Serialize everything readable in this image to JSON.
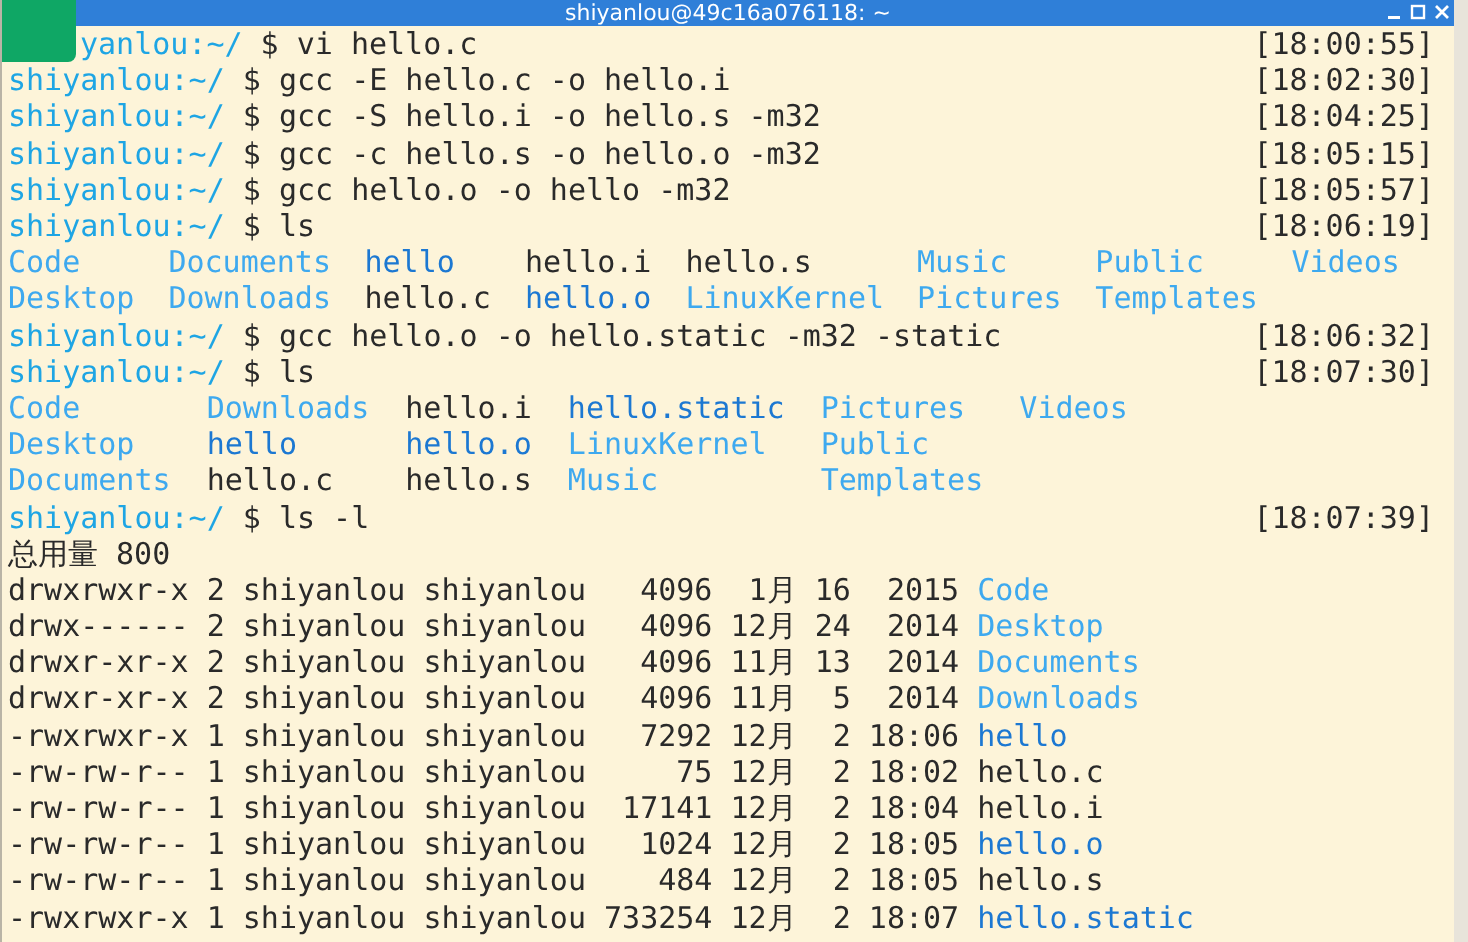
{
  "window": {
    "title": "shiyanlou@49c16a076118: ~"
  },
  "lines": [
    {
      "kind": "command",
      "prompt": "yanlou:~/",
      "command": "$ vi hello.c",
      "time": "[18:00:55]"
    },
    {
      "kind": "command",
      "prompt": "shiyanlou:~/",
      "command": "$ gcc -E hello.c -o hello.i",
      "time": "[18:02:30]"
    },
    {
      "kind": "command",
      "prompt": "shiyanlou:~/",
      "command": "$ gcc -S hello.i -o hello.s -m32",
      "time": "[18:04:25]"
    },
    {
      "kind": "command",
      "prompt": "shiyanlou:~/",
      "command": "$ gcc -c hello.s -o hello.o -m32",
      "time": "[18:05:15]"
    },
    {
      "kind": "command",
      "prompt": "shiyanlou:~/",
      "command": "$ gcc hello.o -o hello -m32",
      "time": "[18:05:57]"
    },
    {
      "kind": "command",
      "prompt": "shiyanlou:~/",
      "command": "$ ls",
      "time": "[18:06:19]"
    },
    {
      "kind": "listing",
      "columns": [
        [
          {
            "name": "Code",
            "kind": "dir"
          },
          {
            "name": "Desktop",
            "kind": "dir"
          }
        ],
        [
          {
            "name": "Documents",
            "kind": "dir"
          },
          {
            "name": "Downloads",
            "kind": "dir"
          }
        ],
        [
          {
            "name": "hello",
            "kind": "binary"
          },
          {
            "name": "hello.c",
            "kind": "plain"
          }
        ],
        [
          {
            "name": "hello.i",
            "kind": "plain"
          },
          {
            "name": "hello.o",
            "kind": "binary"
          }
        ],
        [
          {
            "name": "hello.s",
            "kind": "plain"
          },
          {
            "name": "LinuxKernel",
            "kind": "dir"
          }
        ],
        [
          {
            "name": "Music",
            "kind": "dir"
          },
          {
            "name": "Pictures",
            "kind": "dir"
          }
        ],
        [
          {
            "name": "Public",
            "kind": "dir"
          },
          {
            "name": "Templates",
            "kind": "dir"
          }
        ],
        [
          {
            "name": "Videos",
            "kind": "dir"
          }
        ]
      ]
    },
    {
      "kind": "command",
      "prompt": "shiyanlou:~/",
      "command": "$ gcc hello.o -o hello.static -m32 -static",
      "time": "[18:06:32]"
    },
    {
      "kind": "command",
      "prompt": "shiyanlou:~/",
      "command": "$ ls",
      "time": "[18:07:30]"
    },
    {
      "kind": "listing",
      "columns": [
        [
          {
            "name": "Code",
            "kind": "dir"
          },
          {
            "name": "Desktop",
            "kind": "dir"
          },
          {
            "name": "Documents",
            "kind": "dir"
          }
        ],
        [
          {
            "name": "Downloads",
            "kind": "dir"
          },
          {
            "name": "hello",
            "kind": "binary"
          },
          {
            "name": "hello.c",
            "kind": "plain"
          }
        ],
        [
          {
            "name": "hello.i",
            "kind": "plain"
          },
          {
            "name": "hello.o",
            "kind": "binary"
          },
          {
            "name": "hello.s",
            "kind": "plain"
          }
        ],
        [
          {
            "name": "hello.static",
            "kind": "binary"
          },
          {
            "name": "LinuxKernel",
            "kind": "dir"
          },
          {
            "name": "Music",
            "kind": "dir"
          }
        ],
        [
          {
            "name": "Pictures",
            "kind": "dir"
          },
          {
            "name": "Public",
            "kind": "dir"
          },
          {
            "name": "Templates",
            "kind": "dir"
          }
        ],
        [
          {
            "name": "Videos",
            "kind": "dir"
          }
        ]
      ]
    },
    {
      "kind": "command",
      "prompt": "shiyanlou:~/",
      "command": "$ ls -l",
      "time": "[18:07:39]"
    },
    {
      "kind": "text",
      "text": "总用量 800"
    },
    {
      "kind": "long",
      "details": "drwxrwxr-x 2 shiyanlou shiyanlou   4096  1月 16  2015",
      "file": {
        "name": "Code",
        "kind": "dir"
      }
    },
    {
      "kind": "long",
      "details": "drwx------ 2 shiyanlou shiyanlou   4096 12月 24  2014",
      "file": {
        "name": "Desktop",
        "kind": "dir"
      }
    },
    {
      "kind": "long",
      "details": "drwxr-xr-x 2 shiyanlou shiyanlou   4096 11月 13  2014",
      "file": {
        "name": "Documents",
        "kind": "dir"
      }
    },
    {
      "kind": "long",
      "details": "drwxr-xr-x 2 shiyanlou shiyanlou   4096 11月  5  2014",
      "file": {
        "name": "Downloads",
        "kind": "dir"
      }
    },
    {
      "kind": "long",
      "details": "-rwxrwxr-x 1 shiyanlou shiyanlou   7292 12月  2 18:06",
      "file": {
        "name": "hello",
        "kind": "binary"
      }
    },
    {
      "kind": "long",
      "details": "-rw-rw-r-- 1 shiyanlou shiyanlou     75 12月  2 18:02",
      "file": {
        "name": "hello.c",
        "kind": "plain"
      }
    },
    {
      "kind": "long",
      "details": "-rw-rw-r-- 1 shiyanlou shiyanlou  17141 12月  2 18:04",
      "file": {
        "name": "hello.i",
        "kind": "plain"
      }
    },
    {
      "kind": "long",
      "details": "-rw-rw-r-- 1 shiyanlou shiyanlou   1024 12月  2 18:05",
      "file": {
        "name": "hello.o",
        "kind": "binary"
      }
    },
    {
      "kind": "long",
      "details": "-rw-rw-r-- 1 shiyanlou shiyanlou    484 12月  2 18:05",
      "file": {
        "name": "hello.s",
        "kind": "plain"
      }
    },
    {
      "kind": "long",
      "details": "-rwxrwxr-x 1 shiyanlou shiyanlou 733254 12月  2 18:07",
      "file": {
        "name": "hello.static",
        "kind": "binary"
      }
    }
  ]
}
